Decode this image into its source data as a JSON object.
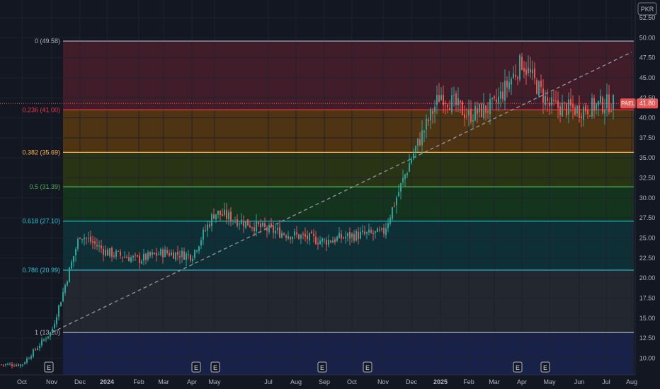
{
  "chart_data": {
    "type": "candlestick",
    "symbol": "PAEL",
    "currency": "PKR",
    "last_price": 41.8,
    "last_price_label": "41.80",
    "colors": {
      "background": "#131722",
      "up": "#26a69a",
      "down": "#ef5350",
      "grid": "#1e222d",
      "axis_text": "#b2b5be",
      "trend": "#9598a1"
    },
    "ylim": [
      8.8,
      54
    ],
    "y_ticks": [
      10,
      12.5,
      15,
      17.5,
      20,
      22.5,
      25,
      27.5,
      30,
      32.5,
      35,
      37.5,
      40,
      42.5,
      45,
      47.5,
      50,
      52.5
    ],
    "y_tick_labels": [
      "10.00",
      "12.50",
      "15.00",
      "17.50",
      "20.00",
      "22.50",
      "25.00",
      "27.50",
      "30.00",
      "32.50",
      "35.00",
      "37.50",
      "40.00",
      "42.50",
      "45.00",
      "47.50",
      "50.00",
      "52.50"
    ],
    "x_tick_labels": [
      "Oct",
      "Nov",
      "Dec",
      "2024",
      "Feb",
      "Mar",
      "Apr",
      "May",
      "Jul",
      "Aug",
      "Sep",
      "Oct",
      "Nov",
      "Dec",
      "2025",
      "Feb",
      "Mar",
      "Apr",
      "May",
      "Jun",
      "Jul",
      "Aug"
    ],
    "earnings_markers": [
      {
        "label": "E",
        "month": "Nov 2023"
      },
      {
        "label": "E",
        "month": "Apr 2024"
      },
      {
        "label": "E",
        "month": "May 2024"
      },
      {
        "label": "E",
        "month": "Sep 2024"
      },
      {
        "label": "E",
        "month": "Oct 2024"
      },
      {
        "label": "E",
        "month": "Mar 2025"
      },
      {
        "label": "E",
        "month": "Apr 2025"
      }
    ],
    "fibonacci": [
      {
        "label": "0 (49.58)",
        "price": 49.58,
        "color": "#b2b5be",
        "fill": "#4a1f2a"
      },
      {
        "label": "0.236 (41.00)",
        "price": 41.0,
        "color": "#f23645",
        "fill": "#5a3a10"
      },
      {
        "label": "0.382 (35.69)",
        "price": 35.69,
        "color": "#ffb74d",
        "fill": "#2e3a12"
      },
      {
        "label": "0.5 (31.39)",
        "price": 31.39,
        "color": "#4caf50",
        "fill": "#163a1c"
      },
      {
        "label": "0.618 (27.10)",
        "price": 27.1,
        "color": "#26c6da",
        "fill": "#0e3438"
      },
      {
        "label": "0.786 (20.99)",
        "price": 20.99,
        "color": "#26c6da",
        "fill": "#262a33"
      },
      {
        "label": "1 (13.20)",
        "price": 13.2,
        "color": "#b2b5be",
        "fill": "#1a2550"
      }
    ],
    "trend_line": {
      "from_month": "Nov 2023",
      "from_price": 13.2,
      "to_month": "Aug 2025",
      "to_price": 48.2
    },
    "price_path": [
      {
        "month": "Oct 2023",
        "price": 9.2
      },
      {
        "month": "Nov 2023",
        "price": 13.4
      },
      {
        "month": "Dec 2023",
        "price": 25.5
      },
      {
        "month": "2024",
        "price": 23.2
      },
      {
        "month": "Feb 2024",
        "price": 22.3
      },
      {
        "month": "Mar 2024",
        "price": 23.2
      },
      {
        "month": "Apr 2024",
        "price": 22.8
      },
      {
        "month": "May 2024",
        "price": 28.2
      },
      {
        "month": "Jul 2024",
        "price": 26.0
      },
      {
        "month": "Aug 2024",
        "price": 25.3
      },
      {
        "month": "Sep 2024",
        "price": 24.6
      },
      {
        "month": "Oct 2024",
        "price": 25.3
      },
      {
        "month": "Nov 2024",
        "price": 25.6
      },
      {
        "month": "Dec 2024",
        "price": 35.0
      },
      {
        "month": "2025",
        "price": 43.0
      },
      {
        "month": "Feb 2025",
        "price": 40.3
      },
      {
        "month": "Mar 2025",
        "price": 41.5
      },
      {
        "month": "Apr 2025",
        "price": 47.0
      },
      {
        "month": "May 2025",
        "price": 41.5
      },
      {
        "month": "Jun 2025",
        "price": 41.0
      },
      {
        "month": "Jul 2025",
        "price": 41.8
      }
    ]
  }
}
